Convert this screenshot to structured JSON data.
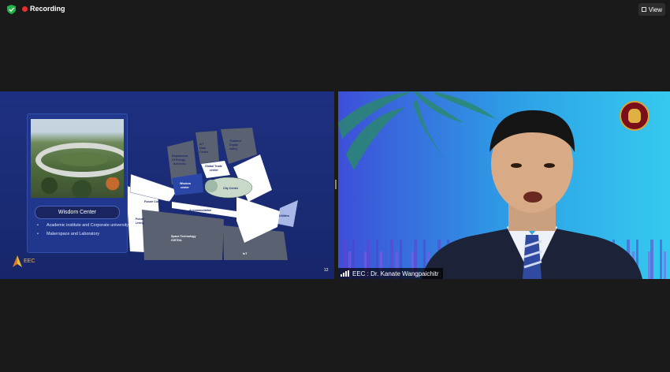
{
  "topbar": {
    "recording_label": "Recording",
    "view_label": "View"
  },
  "slide": {
    "card_title": "Wisdom Center",
    "bullets": [
      "Academic institute and Corporate university",
      "Makerspace and Laboratory"
    ],
    "logo_text": "EEC",
    "page_number": "12",
    "map_labels": {
      "department_of_energy_business": [
        "Department",
        "Of Energy",
        "business"
      ],
      "iot_data_center": [
        "IoT",
        "Data",
        "Center"
      ],
      "thailand_digital_valley": [
        "Thailand",
        "Digital",
        "Valley"
      ],
      "global_trade_center": [
        "Global Trade",
        "center"
      ],
      "wisdom_center": [
        "Wisdom",
        "center"
      ],
      "city_center": "City Center",
      "future_commercial": "Future Commercial",
      "accommodation": "Accommodation",
      "utilities": "Utilities",
      "future_living": [
        "Future",
        "Living"
      ],
      "space_technology": [
        "Space Technology",
        "GISTDA"
      ],
      "iot": "IoT"
    }
  },
  "speaker": {
    "name_label": "EEC : Dr. Kanate Wangpaichitr"
  },
  "colors": {
    "recording": "#e5312c",
    "slide_bg": "#1d2f80",
    "speaker_bg_left": "#3d4fd8",
    "speaker_bg_right": "#36c9ef"
  }
}
